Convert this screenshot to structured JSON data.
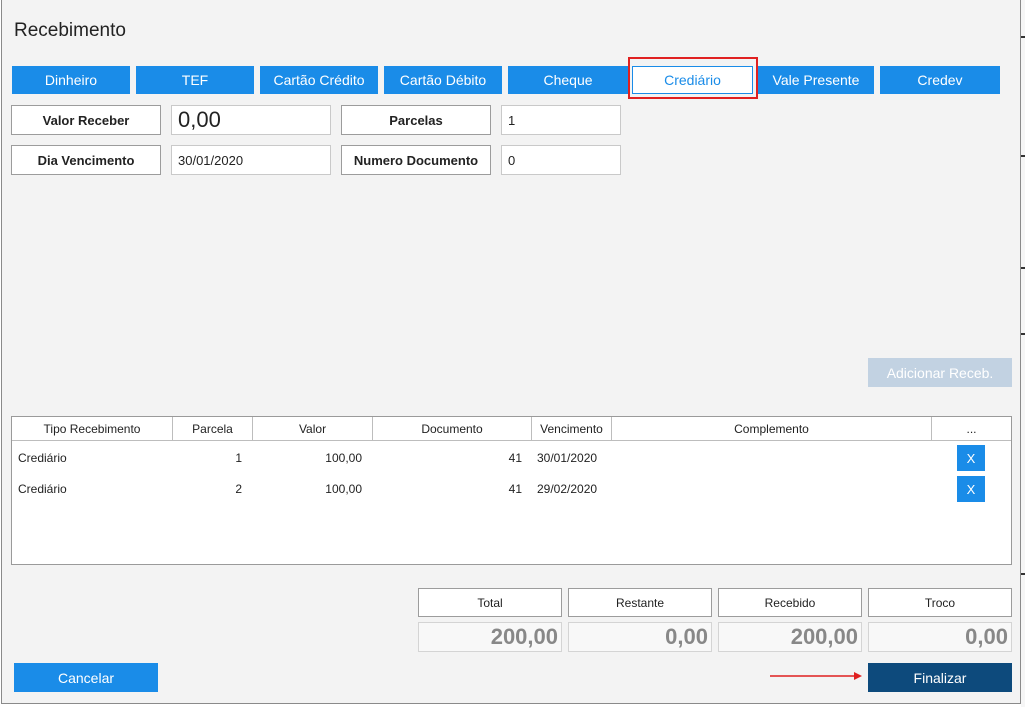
{
  "window": {
    "title": "Recebimento"
  },
  "tabs": [
    {
      "label": "Dinheiro",
      "active": false
    },
    {
      "label": "TEF",
      "active": false
    },
    {
      "label": "Cartão Crédito",
      "active": false
    },
    {
      "label": "Cartão Débito",
      "active": false
    },
    {
      "label": "Cheque",
      "active": false
    },
    {
      "label": "Crediário",
      "active": true
    },
    {
      "label": "Vale Presente",
      "active": false
    },
    {
      "label": "Credev",
      "active": false
    }
  ],
  "form": {
    "valor_receber_label": "Valor Receber",
    "valor_receber_value": "0,00",
    "parcelas_label": "Parcelas",
    "parcelas_value": "1",
    "dia_vencimento_label": "Dia Vencimento",
    "dia_vencimento_value": "30/01/2020",
    "numero_documento_label": "Numero Documento",
    "numero_documento_value": "0"
  },
  "add_button_label": "Adicionar Receb.",
  "grid": {
    "headers": [
      "Tipo Recebimento",
      "Parcela",
      "Valor",
      "Documento",
      "Vencimento",
      "Complemento",
      "..."
    ],
    "rows": [
      {
        "tipo": "Crediário",
        "parcela": "1",
        "valor": "100,00",
        "documento": "41",
        "vencimento": "30/01/2020",
        "complemento": "",
        "action": "X"
      },
      {
        "tipo": "Crediário",
        "parcela": "2",
        "valor": "100,00",
        "documento": "41",
        "vencimento": "29/02/2020",
        "complemento": "",
        "action": "X"
      }
    ]
  },
  "summary": {
    "total_label": "Total",
    "total_value": "200,00",
    "restante_label": "Restante",
    "restante_value": "0,00",
    "recebido_label": "Recebido",
    "recebido_value": "200,00",
    "troco_label": "Troco",
    "troco_value": "0,00"
  },
  "buttons": {
    "cancel": "Cancelar",
    "finish": "Finalizar"
  },
  "colors": {
    "accent": "#1a8ce8",
    "primary_dark": "#0d4a7c",
    "disabled": "#c2d2e2",
    "highlight": "#e02020"
  }
}
